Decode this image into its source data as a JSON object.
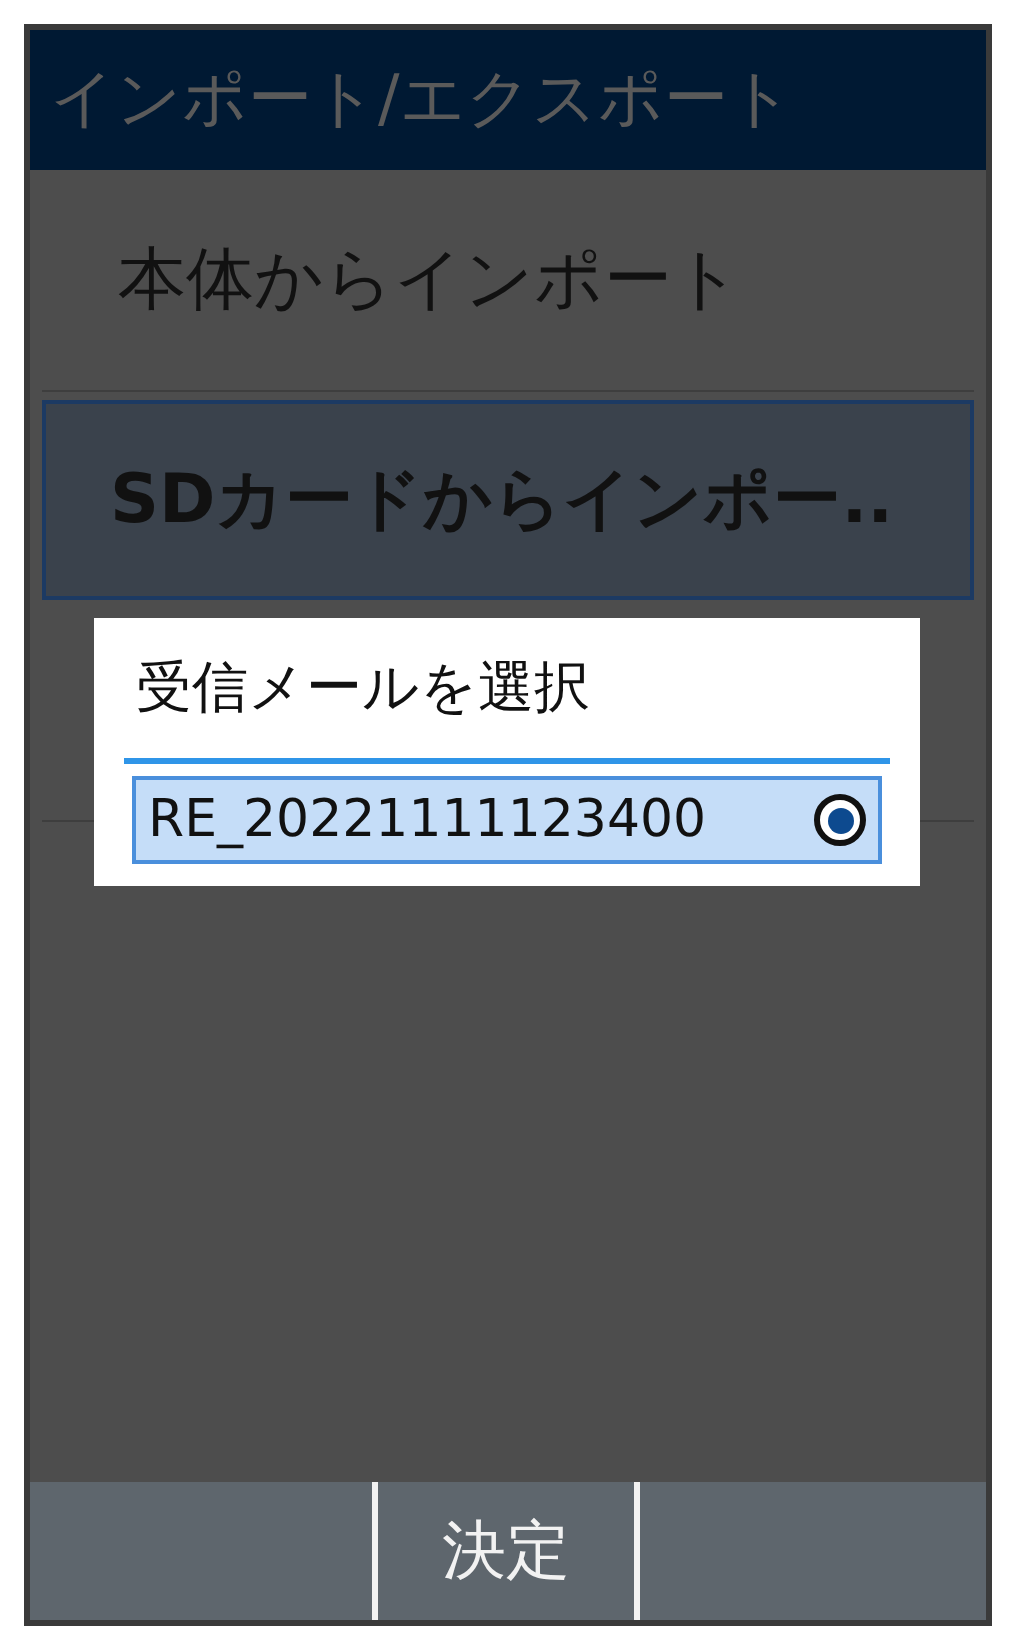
{
  "header": {
    "title": "インポート/エクスポート"
  },
  "menu": [
    {
      "label": "本体からインポート",
      "selected": false
    },
    {
      "label": "SDカードからインポー..",
      "selected": true
    }
  ],
  "dialog": {
    "title": "受信メールを選択",
    "options": [
      {
        "label": "RE_20221111123400",
        "selected": true
      }
    ]
  },
  "softkeys": {
    "center": "決定"
  }
}
